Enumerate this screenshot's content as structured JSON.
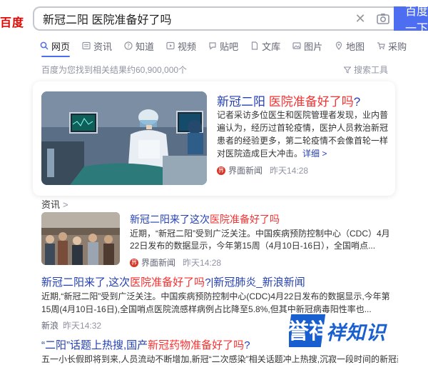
{
  "logo": "百度",
  "search": {
    "query": "新冠二阳 医院准备好了吗",
    "button": "百度一下"
  },
  "colors": {
    "brand_red": "#e10601",
    "link_blue": "#2440b3",
    "highlight_red": "#f73131",
    "accent_blue": "#4e6ef2",
    "watermark_blue": "#1a5fd0"
  },
  "tabs": [
    {
      "label": "网页",
      "icon": "search-icon",
      "active": true
    },
    {
      "label": "资讯",
      "icon": "news-icon"
    },
    {
      "label": "知道",
      "icon": "question-icon"
    },
    {
      "label": "视频",
      "icon": "play-icon"
    },
    {
      "label": "贴吧",
      "icon": "tieba-icon"
    },
    {
      "label": "文库",
      "icon": "doc-icon"
    },
    {
      "label": "图片",
      "icon": "image-icon"
    },
    {
      "label": "地图",
      "icon": "map-icon"
    },
    {
      "label": "采购",
      "icon": "cart-icon"
    }
  ],
  "result_stats": "百度为您找到相关结果约60,900,000个",
  "search_tools": "搜索工具",
  "top_card": {
    "title_pre": "新冠二阳 ",
    "title_hl": "医院准备好了吗",
    "title_post": "?",
    "summary": "记者采访多位医生和医院管理者发现，业内普遍认为，经历过首轮疫情，医护人员救治新冠患者的经验更多，第二轮疫情不会像首轮一样对医院造成巨大冲击。",
    "more": "详细 >",
    "source_badge": "界",
    "source": "界面新闻",
    "time": "昨天14:28"
  },
  "news_section": {
    "heading": "资讯",
    "chevron": ">",
    "title_pre": "新冠二阳来了这次",
    "title_hl": "医院准备好了吗",
    "summary": "近期，“新冠二阳”受到广泛关注。中国疾病预防控制中心（CDC）4月22日发布的数据显示，今年第15周（4月10日-16日），全国哨点...",
    "source_badge": "界",
    "source": "界面新闻",
    "time": "昨天14:28"
  },
  "result1": {
    "title_pre": "新冠二阳来了,这次",
    "title_hl": "医院准备好了吗",
    "title_post": "?|新冠肺炎_新浪新闻",
    "summary": "近期,“新冠二阳”受到广泛关注。中国疾病预防控制中心(CDC)4月22日发布的数据显示,今年第15周(4月10日-16日),全国哨点医院流感样病例占比降至5.8%,但其中新冠病毒阳性率也...",
    "source": "新浪",
    "time": "昨天14:32"
  },
  "result2": {
    "title_pre": "“二阳”话题上热搜,国产",
    "title_hl": "新冠药物准备好了吗",
    "title_post": "?",
    "summary": "五一小长假即将到来,人员流动不断增加,新冠“二次感染”相关话题冲上热搜,沉寂一段时间的新冠药..."
  },
  "watermark": {
    "text": "祥知识",
    "alt": "誉祥"
  }
}
